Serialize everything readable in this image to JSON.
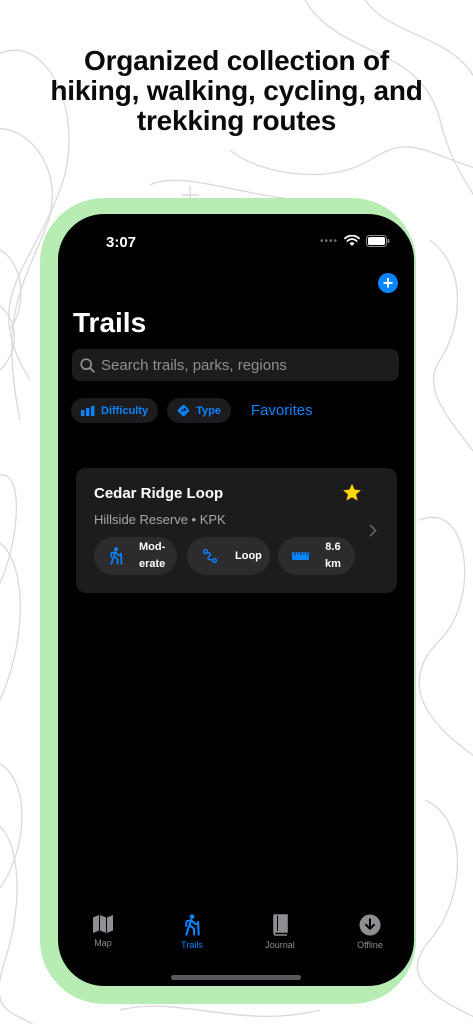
{
  "headline": {
    "line1": "Organized collection of",
    "line2": "hiking, walking, cycling, and",
    "line3": "trekking routes"
  },
  "status_bar": {
    "time": "3:07"
  },
  "header": {
    "title": "Trails",
    "add_icon": "plus-circle-icon"
  },
  "search": {
    "placeholder": "Search trails, parks, regions",
    "icon": "search-icon"
  },
  "filters": {
    "difficulty": {
      "label": "Difficulty",
      "icon": "bars-icon"
    },
    "type": {
      "label": "Type",
      "icon": "route-diamond-icon"
    },
    "favorites": {
      "label": "Favorites"
    }
  },
  "trails": [
    {
      "name": "Cedar Ridge Loop",
      "location": "Hillside Reserve • KPK",
      "favorite": true,
      "difficulty": {
        "line1": "Mod-",
        "line2": "erate",
        "icon": "hiker-icon"
      },
      "route_type": {
        "label": "Loop",
        "icon": "route-icon"
      },
      "distance": {
        "line1": "8.6",
        "line2": "km",
        "icon": "ruler-icon"
      }
    }
  ],
  "tab_bar": [
    {
      "label": "Map",
      "icon": "map-icon",
      "active": false
    },
    {
      "label": "Trails",
      "icon": "hiker-icon",
      "active": true
    },
    {
      "label": "Journal",
      "icon": "book-icon",
      "active": false
    },
    {
      "label": "Offline",
      "icon": "download-circle-icon",
      "active": false
    }
  ],
  "colors": {
    "accent": "#0A84FF",
    "frame": "#B7ECB2",
    "star": "#FFD60A",
    "card": "#1C1C1E",
    "chip": "#2C2C2E"
  }
}
